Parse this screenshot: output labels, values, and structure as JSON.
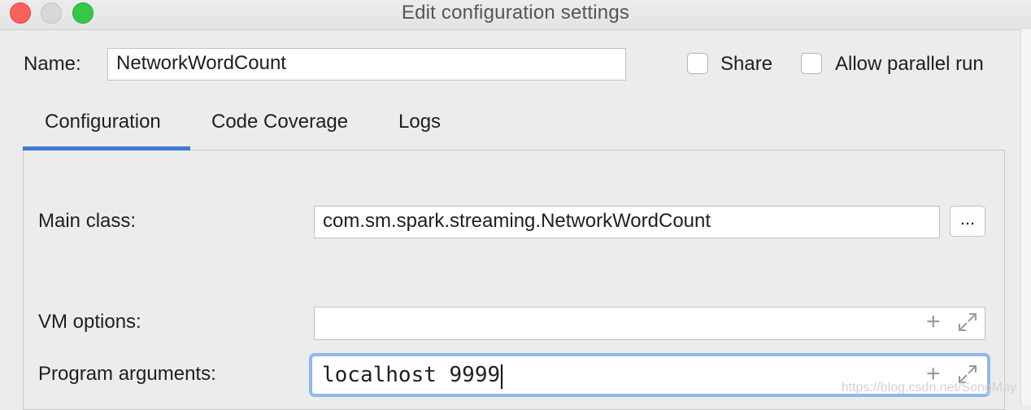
{
  "window": {
    "title": "Edit configuration settings"
  },
  "name_row": {
    "label": "Name:",
    "value": "NetworkWordCount",
    "share_label": "Share",
    "share_checked": false,
    "parallel_label": "Allow parallel run",
    "parallel_checked": false
  },
  "tabs": [
    {
      "label": "Configuration",
      "active": true
    },
    {
      "label": "Code Coverage",
      "active": false
    },
    {
      "label": "Logs",
      "active": false
    }
  ],
  "form": {
    "main_class_label": "Main class:",
    "main_class_value": "com.sm.spark.streaming.NetworkWordCount",
    "browse_label": "...",
    "vm_options_label": "VM options:",
    "vm_options_value": "",
    "program_args_label": "Program arguments:",
    "program_args_value": "localhost 9999"
  },
  "icons": {
    "add": "plus-icon",
    "expand": "expand-icon"
  },
  "watermark": "https://blog.csdn.net/SongMay",
  "colors": {
    "accent": "#3d7bcf",
    "focus_ring": "#8fb8ee",
    "close": "#fc605b",
    "maximize": "#34c84a"
  }
}
